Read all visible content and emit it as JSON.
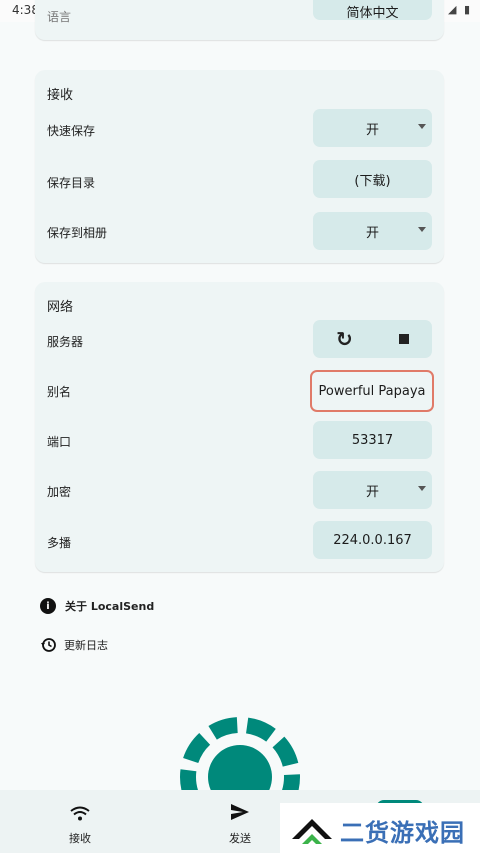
{
  "status_bar": {
    "time": "4:38"
  },
  "language_card": {
    "label": "语言",
    "value": "简体中文"
  },
  "receive_card": {
    "title": "接收",
    "rows": [
      {
        "label": "快速保存",
        "value": "开",
        "dropdown": true
      },
      {
        "label": "保存目录",
        "value": "(下载)",
        "dropdown": false
      },
      {
        "label": "保存到相册",
        "value": "开",
        "dropdown": true
      }
    ]
  },
  "network_card": {
    "title": "网络",
    "server": {
      "label": "服务器",
      "icons": [
        "refresh-icon",
        "stop-icon"
      ]
    },
    "alias": {
      "label": "别名",
      "value": "Powerful Papaya"
    },
    "port": {
      "label": "端口",
      "value": "53317"
    },
    "encryption": {
      "label": "加密",
      "value": "开"
    },
    "multicast": {
      "label": "多播",
      "value": "224.0.0.167"
    }
  },
  "links": {
    "about": "关于 LocalSend",
    "changelog": "更新日志"
  },
  "bottom_nav": {
    "receive": "接收",
    "send": "发送"
  },
  "watermark": {
    "text": "二货游戏园"
  },
  "colors": {
    "accent": "#00897b",
    "card_bg": "#eef5f5",
    "control_bg": "#d6eaea",
    "highlight_border": "#e07a68"
  }
}
